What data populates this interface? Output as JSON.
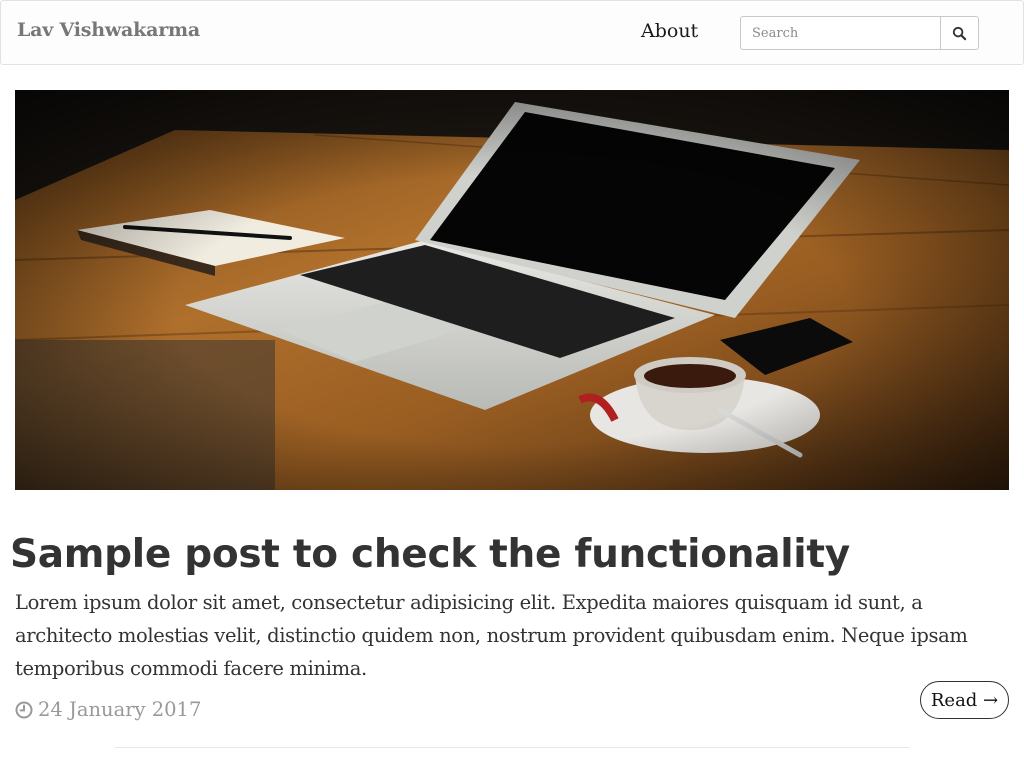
{
  "navbar": {
    "brand": "Lav Vishwakarma",
    "about_link": "About",
    "search": {
      "placeholder": "Search"
    }
  },
  "hero": {
    "image": "laptop-on-wooden-table-with-notebook-pen-coffee-and-phone"
  },
  "post": {
    "title": "Sample post to check the functionality",
    "excerpt": "Lorem ipsum dolor sit amet, consectetur adipisicing elit. Expedita maiores quisquam id sunt, a architecto molestias velit, distinctio quidem non, nostrum provident quibusdam enim. Neque ipsam temporibus commodi facere minima.",
    "date": "24 January 2017",
    "read_label": "Read →"
  },
  "icons": {
    "search": "search-icon",
    "date": "clock-icon"
  },
  "colors": {
    "brand": "#777777",
    "date": "#999999",
    "text": "#333333"
  }
}
